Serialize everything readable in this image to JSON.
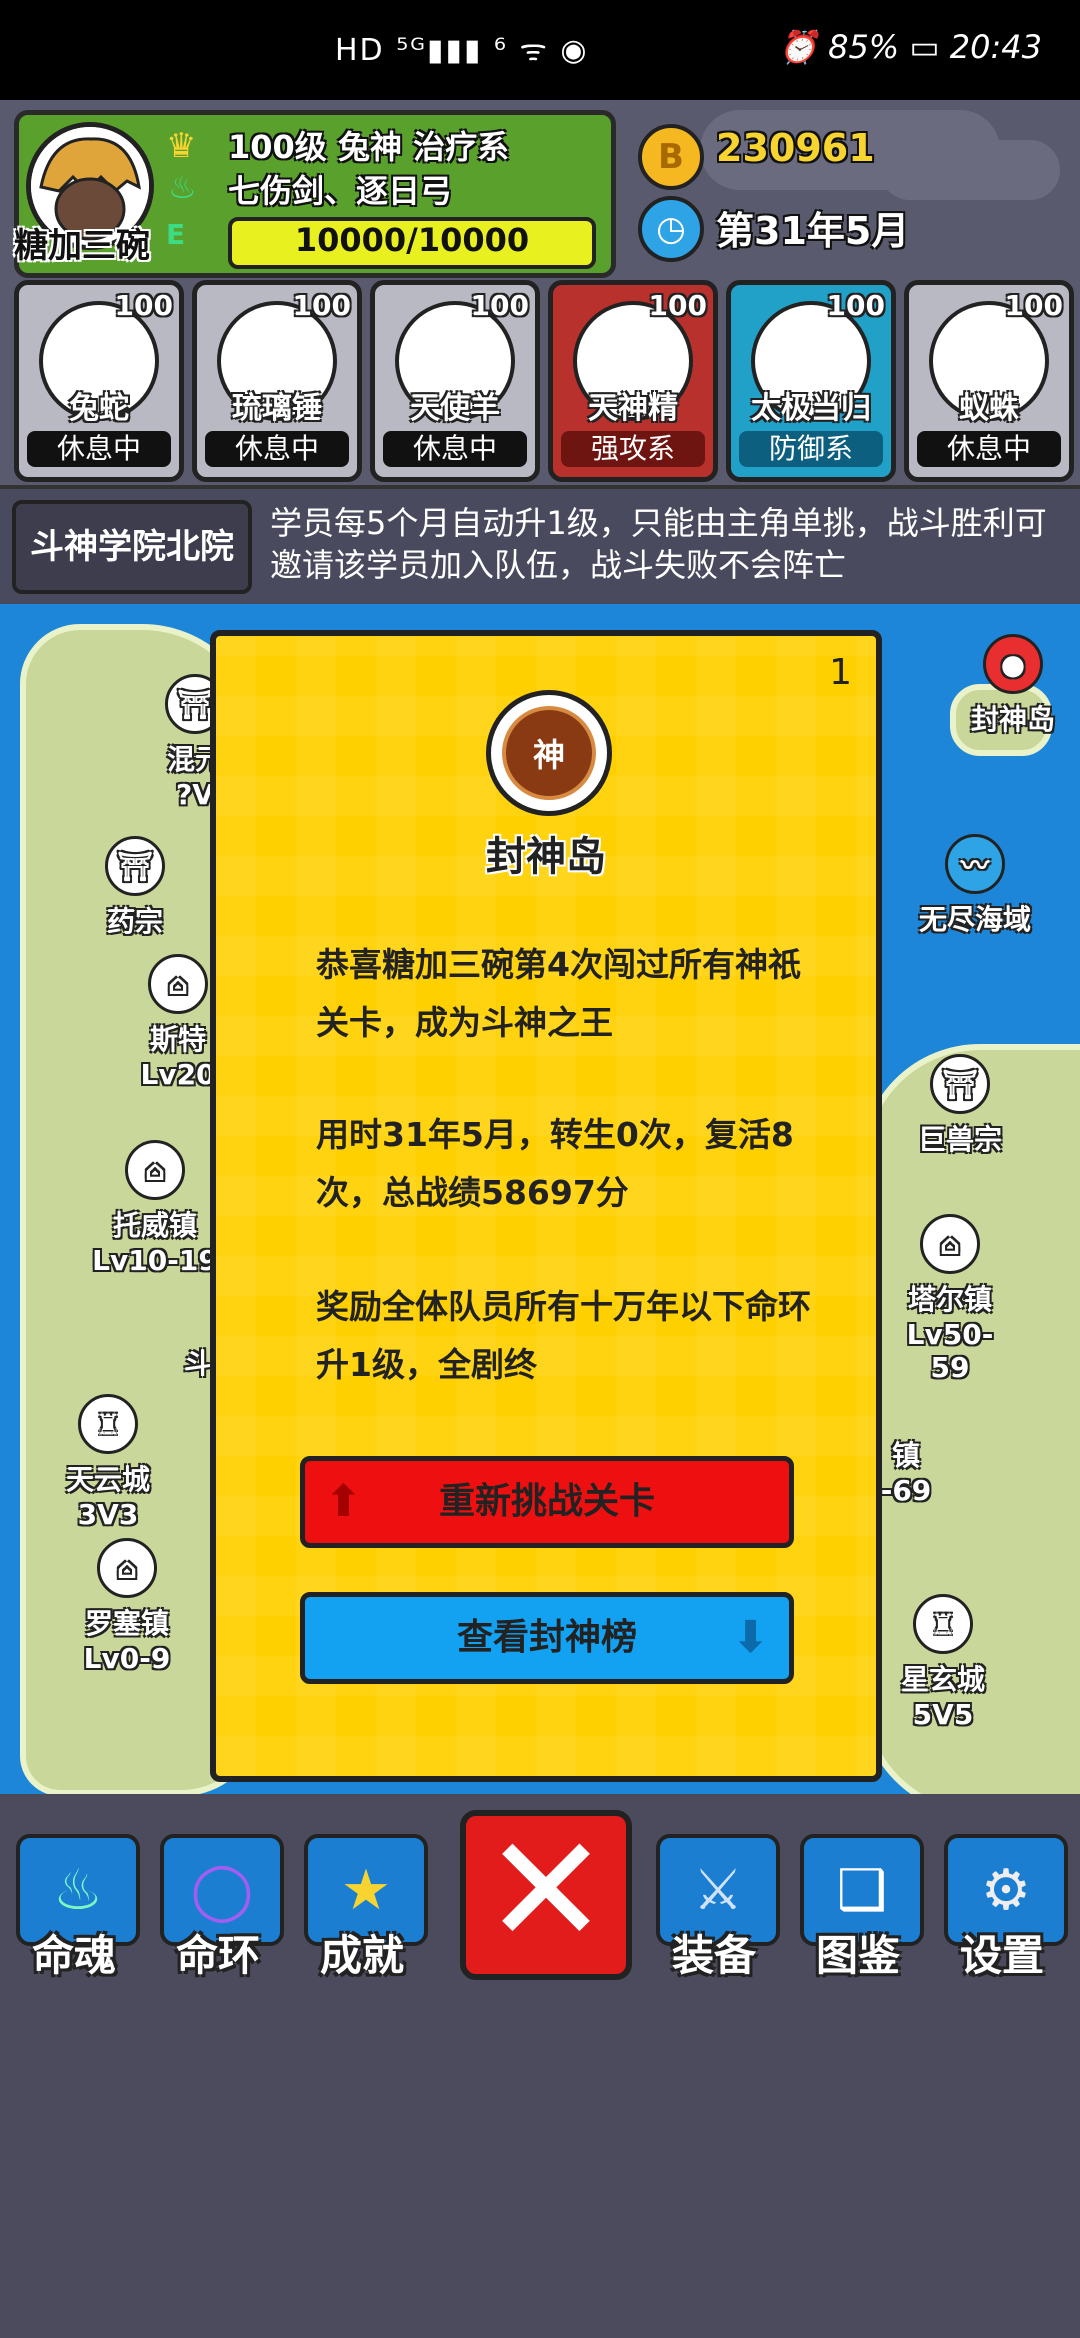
{
  "status_bar": {
    "left": "HD ⁵ᴳ▮▮▮ ⁶ ᯤ ◉",
    "battery": "85%",
    "time": "20:43"
  },
  "player": {
    "name": "糖加三碗",
    "level_title": "100级 兔神 治疗系",
    "weapons": "七伤剑、逐日弓",
    "hp": "10000/10000",
    "gold": "230961",
    "date": "第31年5月"
  },
  "team": [
    {
      "level": "100",
      "name": "兔蛇",
      "status": "休息中",
      "color": "#b9b9c4"
    },
    {
      "level": "100",
      "name": "琉璃锤",
      "status": "休息中",
      "color": "#b9b9c4"
    },
    {
      "level": "100",
      "name": "天使羊",
      "status": "休息中",
      "color": "#b9b9c4"
    },
    {
      "level": "100",
      "name": "天神精",
      "status": "强攻系",
      "color": "#b8312c"
    },
    {
      "level": "100",
      "name": "太极当归",
      "status": "防御系",
      "color": "#21a0c8"
    },
    {
      "level": "100",
      "name": "蚁蛛",
      "status": "休息中",
      "color": "#b9b9c4"
    }
  ],
  "academy": {
    "name": "斗神学院北院",
    "description": "学员每5个月自动升1级，只能由主角单挑，战斗胜利可邀请该学员加入队伍，战斗失败不会阵亡"
  },
  "map": {
    "locations": [
      {
        "name": "封神岛",
        "sub": ""
      },
      {
        "name": "混元",
        "sub": "?V"
      },
      {
        "name": "药宗",
        "sub": ""
      },
      {
        "name": "无尽海域",
        "sub": ""
      },
      {
        "name": "斯特",
        "sub": "Lv20"
      },
      {
        "name": "巨兽宗",
        "sub": ""
      },
      {
        "name": "托威镇",
        "sub": "Lv10-19"
      },
      {
        "name": "塔尔镇",
        "sub": "Lv50-59"
      },
      {
        "name": "斗",
        "sub": ""
      },
      {
        "name": "天云城",
        "sub": "3V3"
      },
      {
        "name": "镇",
        "sub": "-69"
      },
      {
        "name": "罗塞镇",
        "sub": "Lv0-9"
      },
      {
        "name": "星玄城",
        "sub": "5V5"
      }
    ]
  },
  "dialog": {
    "count": "1",
    "emblem_char": "神",
    "title": "封神岛",
    "para1": "恭喜糖加三碗第4次闯过所有神祇关卡，成为斗神之王",
    "para2": "用时31年5月，转生0次，复活8次，总战绩58697分",
    "para3": "奖励全体队员所有十万年以下命环升1级，全剧终",
    "btn_retry": "重新挑战关卡",
    "btn_rank": "查看封神榜"
  },
  "nav": {
    "items": [
      {
        "label": "命魂",
        "icon": "soul-flame-icon"
      },
      {
        "label": "命环",
        "icon": "ring-icon"
      },
      {
        "label": "成就",
        "icon": "star-badge-icon"
      },
      {
        "label": "装备",
        "icon": "sword-icon"
      },
      {
        "label": "图鉴",
        "icon": "book-icon"
      },
      {
        "label": "设置",
        "icon": "gear-icon"
      }
    ],
    "close_symbol": "✕"
  }
}
